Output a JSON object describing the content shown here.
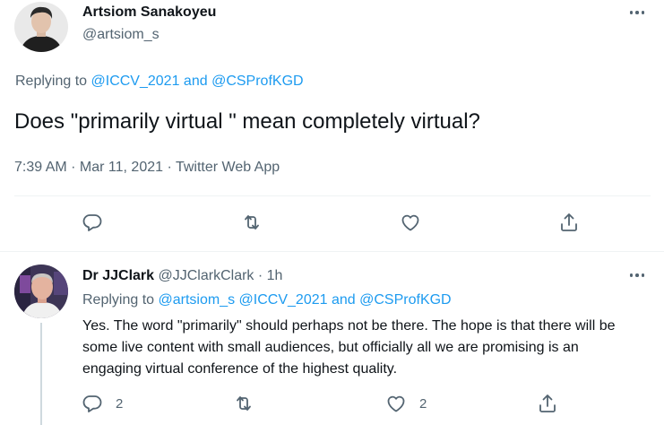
{
  "tweet": {
    "author_name": "Artsiom Sanakoyeu",
    "author_handle": "@artsiom_s",
    "replying_prefix": "Replying to",
    "replying_to_1": "@ICCV_2021",
    "replying_and": "and",
    "replying_to_2": "@CSProfKGD",
    "text": "Does \"primarily virtual \" mean completely virtual?",
    "meta": "7:39 AM · Mar 11, 2021 · Twitter Web App"
  },
  "reply": {
    "author_name": "Dr JJClark",
    "author_handle": "@JJClarkClark",
    "time": "· 1h",
    "replying_prefix": "Replying to",
    "replying_to_1": "@artsiom_s",
    "replying_to_2": "@ICCV_2021",
    "replying_and": "and",
    "replying_to_3": "@CSProfKGD",
    "text": "Yes. The word \"primarily\" should perhaps not be there. The hope is that there will be some live content with small audiences, but officially all we are promising is an engaging virtual conference of the highest quality.",
    "reply_count": "2",
    "like_count": "2"
  },
  "colors": {
    "link": "#1d9bf0",
    "muted": "#536471",
    "divider": "#eff3f4"
  },
  "icons": [
    "more-icon",
    "reply-icon",
    "retweet-icon",
    "like-icon",
    "share-icon"
  ]
}
